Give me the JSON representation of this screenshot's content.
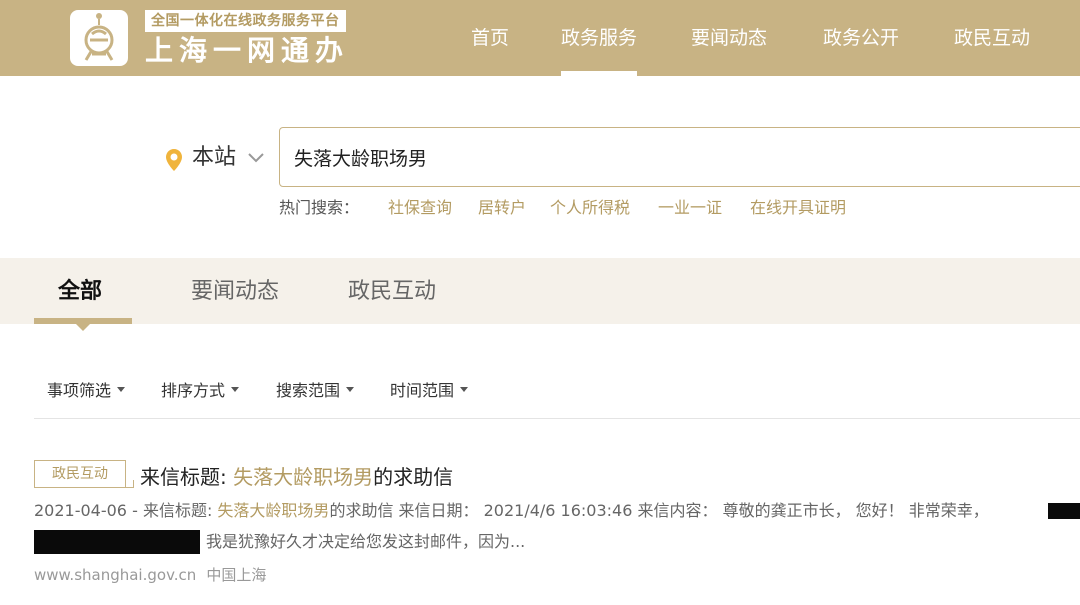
{
  "header": {
    "slogan": "全国一体化在线政务服务平台",
    "brand": "上海一网通办",
    "nav": [
      "首页",
      "政务服务",
      "要闻动态",
      "政务公开",
      "政民互动"
    ],
    "active_nav": "政务服务"
  },
  "search": {
    "scope": "本站",
    "query": "失落大龄职场男",
    "hot_label": "热门搜索：",
    "hot_links": [
      "社保查询",
      "居转户",
      "个人所得税",
      "一业一证",
      "在线开具证明"
    ]
  },
  "tabs": {
    "items": [
      "全部",
      "要闻动态",
      "政民互动"
    ],
    "active": "全部"
  },
  "filters": [
    "事项筛选",
    "排序方式",
    "搜索范围",
    "时间范围"
  ],
  "result": {
    "badge": "政民互动",
    "title_prefix": "来信标题: ",
    "title_highlight": "失落大龄职场男",
    "title_suffix": "的求助信",
    "snippet_date": "2021-04-06 - ",
    "snippet_prefix": "来信标题: ",
    "snippet_highlight": "失落大龄职场男",
    "snippet_rest": "的求助信 来信日期： 2021/4/6 16:03:46 来信内容： 尊敬的龚正市长， 您好！ 非常荣幸，",
    "snippet_line2": "我是犹豫好久才决定给您发这封邮件，因为...",
    "source_url": "www.shanghai.gov.cn",
    "source_region": "中国上海"
  },
  "colors": {
    "brand_gold": "#c8b384",
    "highlight_gold": "#b39b62",
    "tab_band": "#f5f1ea"
  }
}
